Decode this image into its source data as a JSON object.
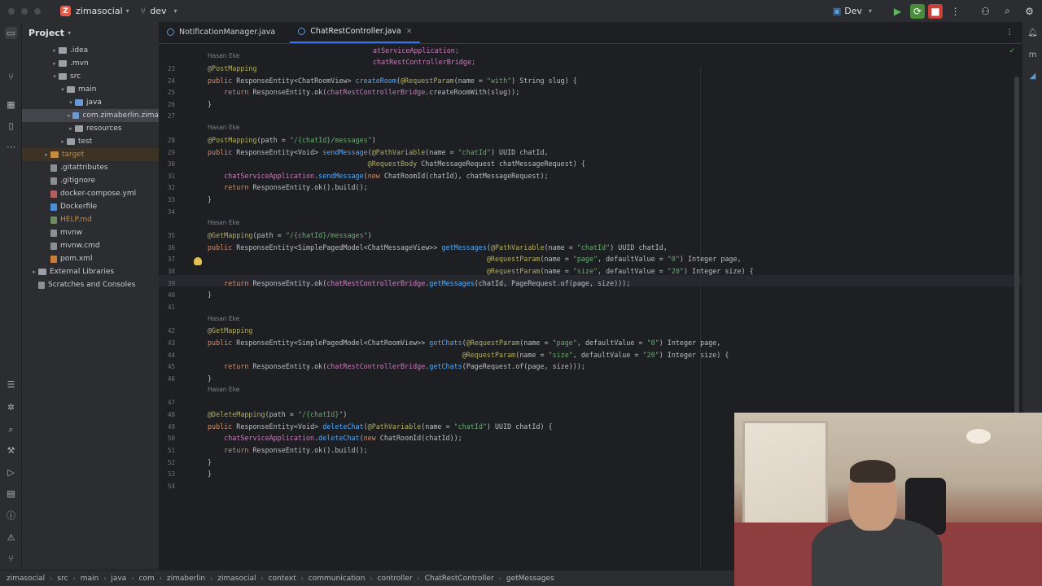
{
  "titlebar": {
    "project_badge": "Z",
    "project_name": "zimasocial",
    "branch": "dev",
    "run_config": "Dev"
  },
  "project_panel": {
    "title": "Project",
    "tree": [
      {
        "label": ".idea",
        "kind": "folder"
      },
      {
        "label": ".mvn",
        "kind": "folder"
      },
      {
        "label": "src",
        "kind": "folder"
      },
      {
        "label": "main",
        "kind": "folder"
      },
      {
        "label": "java",
        "kind": "folder-blue"
      },
      {
        "label": "com.zimaberlin.zima",
        "kind": "package"
      },
      {
        "label": "resources",
        "kind": "folder"
      },
      {
        "label": "test",
        "kind": "folder"
      },
      {
        "label": "target",
        "kind": "folder-orange"
      },
      {
        "label": ".gitattributes",
        "kind": "file"
      },
      {
        "label": ".gitignore",
        "kind": "file"
      },
      {
        "label": "docker-compose.yml",
        "kind": "yml"
      },
      {
        "label": "Dockerfile",
        "kind": "docker"
      },
      {
        "label": "HELP.md",
        "kind": "md"
      },
      {
        "label": "mvnw",
        "kind": "file"
      },
      {
        "label": "mvnw.cmd",
        "kind": "file"
      },
      {
        "label": "pom.xml",
        "kind": "xml"
      },
      {
        "label": "External Libraries",
        "kind": "lib"
      },
      {
        "label": "Scratches and Consoles",
        "kind": "scratch"
      }
    ]
  },
  "tabs": [
    {
      "label": "NotificationManager.java"
    },
    {
      "label": "ChatRestController.java"
    }
  ],
  "code": {
    "author": "Hasan Eke",
    "top1": "atServiceApplication;",
    "top2": "chatRestControllerBridge;",
    "lines": [
      {
        "n": "23",
        "text": "@PostMapping"
      },
      {
        "n": "24",
        "text": "public ResponseEntity<ChatRoomView> createRoom(@RequestParam(name = \"with\") String slug) {"
      },
      {
        "n": "25",
        "text": "    return ResponseEntity.ok(chatRestControllerBridge.createRoomWith(slug));"
      },
      {
        "n": "26",
        "text": "}"
      },
      {
        "n": "27",
        "text": ""
      },
      {
        "n": "28",
        "text": "@PostMapping(path = \"/{chatId}/messages\")"
      },
      {
        "n": "29",
        "text": "public ResponseEntity<Void> sendMessage(@PathVariable(name = \"chatId\") UUID chatId,"
      },
      {
        "n": "30",
        "text": "                                       @RequestBody ChatMessageRequest chatMessageRequest) {"
      },
      {
        "n": "31",
        "text": "    chatServiceApplication.sendMessage(new ChatRoomId(chatId), chatMessageRequest);"
      },
      {
        "n": "32",
        "text": "    return ResponseEntity.ok().build();"
      },
      {
        "n": "33",
        "text": "}"
      },
      {
        "n": "34",
        "text": ""
      },
      {
        "n": "35",
        "text": "@GetMapping(path = \"/{chatId}/messages\")"
      },
      {
        "n": "36",
        "text": "public ResponseEntity<SimplePagedModel<ChatMessageView>> getMessages(@PathVariable(name = \"chatId\") UUID chatId,"
      },
      {
        "n": "37",
        "text": "                                                                    @RequestParam(name = \"page\", defaultValue = \"0\") Integer page,"
      },
      {
        "n": "38",
        "text": "                                                                    @RequestParam(name = \"size\", defaultValue = \"20\") Integer size) {"
      },
      {
        "n": "39",
        "text": "    return ResponseEntity.ok(chatRestControllerBridge.getMessages(chatId, PageRequest.of(page, size)));"
      },
      {
        "n": "40",
        "text": "}"
      },
      {
        "n": "41",
        "text": ""
      },
      {
        "n": "42",
        "text": "@GetMapping"
      },
      {
        "n": "43",
        "text": "public ResponseEntity<SimplePagedModel<ChatRoomView>> getChats(@RequestParam(name = \"page\", defaultValue = \"0\") Integer page,"
      },
      {
        "n": "44",
        "text": "                                                              @RequestParam(name = \"size\", defaultValue = \"20\") Integer size) {"
      },
      {
        "n": "45",
        "text": "    return ResponseEntity.ok(chatRestControllerBridge.getChats(PageRequest.of(page, size)));"
      },
      {
        "n": "46",
        "text": "}"
      },
      {
        "n": "47",
        "text": ""
      },
      {
        "n": "48",
        "text": "@DeleteMapping(path = \"/{chatId}\")"
      },
      {
        "n": "49",
        "text": "public ResponseEntity<Void> deleteChat(@PathVariable(name = \"chatId\") UUID chatId) {"
      },
      {
        "n": "50",
        "text": "    chatServiceApplication.deleteChat(new ChatRoomId(chatId));"
      },
      {
        "n": "51",
        "text": "    return ResponseEntity.ok().build();"
      },
      {
        "n": "52",
        "text": "}"
      },
      {
        "n": "53",
        "text": "}"
      },
      {
        "n": "54",
        "text": ""
      }
    ]
  },
  "breadcrumb": [
    "zimasocial",
    "src",
    "main",
    "java",
    "com",
    "zimaberlin",
    "zimasocial",
    "context",
    "communication",
    "controller",
    "ChatRestController",
    "getMessages"
  ]
}
